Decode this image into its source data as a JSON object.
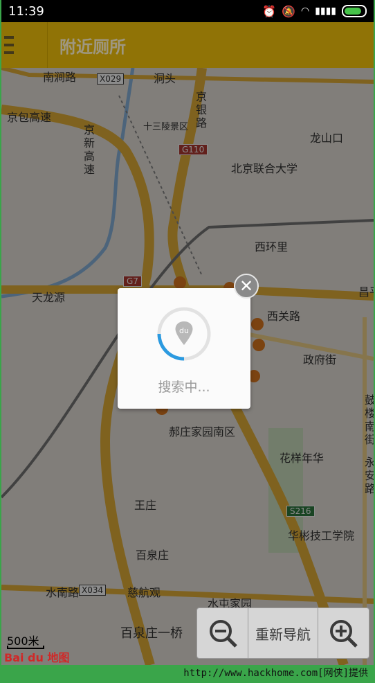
{
  "status_bar": {
    "time": "11:39",
    "icons": [
      "alarm-icon",
      "mute-icon",
      "wifi-icon",
      "signal-icon",
      "battery-icon"
    ]
  },
  "app_bar": {
    "title": "附近厕所",
    "menu_icon": "menu-icon"
  },
  "map": {
    "labels": [
      "南涧路",
      "洞头",
      "十三陵景区",
      "京银路",
      "京包高速",
      "京新高速",
      "龙山口",
      "北京联合大学",
      "西环里",
      "天龙源",
      "昌平",
      "西关路",
      "政府街",
      "郝庄家园南区",
      "花样年华",
      "王庄",
      "华彬技工学院",
      "百泉庄",
      "水南路",
      "慈航观",
      "水屯家园",
      "百泉庄一桥",
      "鼓楼南街",
      "永安路"
    ],
    "shields": [
      "X029",
      "G110",
      "G7",
      "X034",
      "S216"
    ],
    "scale": "500米",
    "logo": "Bai du 地图"
  },
  "dialog": {
    "loading_text": "搜索中...",
    "spinner_icon": "baidu-location-spinner-icon",
    "close_icon": "close-icon"
  },
  "controls": {
    "zoom_out_icon": "zoom-out-icon",
    "renavigate_label": "重新导航",
    "zoom_in_icon": "zoom-in-icon"
  },
  "watermark": "http://www.hackhome.com[网侠]提供",
  "colors": {
    "app_bar": "#e8ba0a",
    "highway": "#f0b830",
    "frame": "#3aa54a",
    "accent_spinner": "#2b9ae0"
  }
}
